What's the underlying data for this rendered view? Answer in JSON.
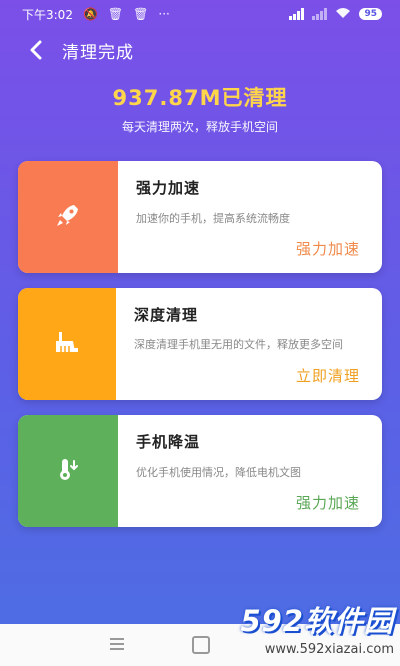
{
  "status_bar": {
    "time": "下午3:02",
    "battery": "95"
  },
  "header": {
    "title": "清理完成"
  },
  "summary": {
    "cleaned": "937.87M已清理",
    "subtitle": "每天清理两次，释放手机空间"
  },
  "cards": [
    {
      "title": "强力加速",
      "desc": "加速你的手机，提高系统流畅度",
      "action": "强力加速",
      "color": "#f97b52",
      "action_color": "#f08a4a",
      "icon": "rocket-icon"
    },
    {
      "title": "深度清理",
      "desc": "深度清理手机里无用的文件，释放更多空间",
      "action": "立即清理",
      "color": "#ffa717",
      "action_color": "#f0a020",
      "icon": "broom-icon"
    },
    {
      "title": "手机降温",
      "desc": "优化手机使用情况，降低电机文图",
      "action": "强力加速",
      "color": "#5eb05a",
      "action_color": "#5aa856",
      "icon": "thermometer-icon"
    }
  ],
  "watermark": {
    "brand": "592软件园",
    "url": "www.592xiazai.com"
  }
}
